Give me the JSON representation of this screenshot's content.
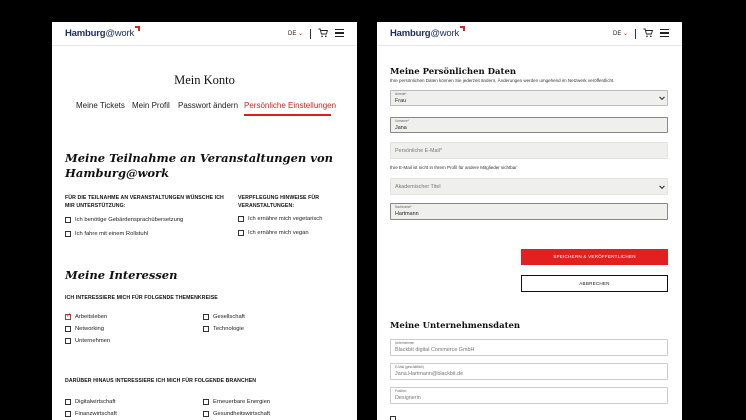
{
  "brand": {
    "name": "Hamburg",
    "at": "@work",
    "accent": "#e1201f",
    "navy": "#1d2d5b"
  },
  "header": {
    "lang": "DE",
    "cart_icon": "shopping-cart-icon",
    "menu_icon": "hamburger-menu-icon"
  },
  "left": {
    "title": "Mein Konto",
    "tabs": [
      {
        "label": "Meine Tickets"
      },
      {
        "label": "Mein Profil"
      },
      {
        "label": "Passwort ändern"
      },
      {
        "label": "Persönliche Einstellungen",
        "active": true
      }
    ],
    "events": {
      "heading": "Meine Teilnahme an Veranstaltungen von Hamburg@work",
      "support_label": "Für die Teilnahme an Veranstaltungen wünsche ich mir Unterstützung:",
      "support_options": [
        {
          "label": "Ich benötige Gebärdensprachübersetzung",
          "checked": false
        },
        {
          "label": "Ich fahre mit einem Rollstuhl",
          "checked": false
        }
      ],
      "food_label": "Verpflegung Hinweise für Veranstaltungen:",
      "food_options": [
        {
          "label": "Ich ernähre mich vegetarisch",
          "checked": false
        },
        {
          "label": "Ich ernähre mich vegan",
          "checked": false
        }
      ]
    },
    "interests": {
      "heading": "Meine Interessen",
      "topics_label": "Ich interessiere mich für folgende Themenkreise",
      "topics_col1": [
        {
          "label": "Arbeitsleben",
          "checked": true
        },
        {
          "label": "Networking",
          "checked": false
        },
        {
          "label": "Unternehmen",
          "checked": false
        }
      ],
      "topics_col2": [
        {
          "label": "Gesellschaft",
          "checked": false
        },
        {
          "label": "Technologie",
          "checked": false
        }
      ],
      "branches_label": "Darüber hinaus interessiere ich mich für folgende Branchen",
      "branches_col1": [
        {
          "label": "Digitalwirtschaft",
          "checked": false
        },
        {
          "label": "Finanzwirtschaft",
          "checked": false
        }
      ],
      "branches_col2": [
        {
          "label": "Erneuerbare Energien",
          "checked": false
        },
        {
          "label": "Gesundheitswirtschaft",
          "checked": false
        }
      ]
    }
  },
  "right": {
    "personal": {
      "heading": "Meine Persönlichen Daten",
      "intro": "Ihre persönlichen Daten können Sie jederzeit ändern, Änderungen werden umgehend im Netzwerk veröffentlicht.",
      "salutation_label": "Anrede*",
      "salutation_value": "Frau",
      "firstname_label": "Vorname*",
      "firstname_value": "Jana",
      "email_placeholder": "Persönliche E-Mail*",
      "email_hint": "Ihre E-Mail ist nicht in Ihrem Profil für andere Mitglieder sichtbar",
      "title_placeholder": "Akademischer Titel",
      "lastname_label": "Nachname*",
      "lastname_value": "Hartmann",
      "save_button": "Speichern & veröffentlichen",
      "cancel_button": "Abbrechen"
    },
    "company": {
      "heading": "Meine Unternehmensdaten",
      "company_label": "Unternehmen",
      "company_value": "Blackbit digital Commerce GmbH",
      "work_email_label": "E-Mail (geschäftlich)",
      "work_email_value": "Jana.Hartmann@blackbit.de",
      "position_label": "Position",
      "position_value": "Designerin"
    }
  }
}
